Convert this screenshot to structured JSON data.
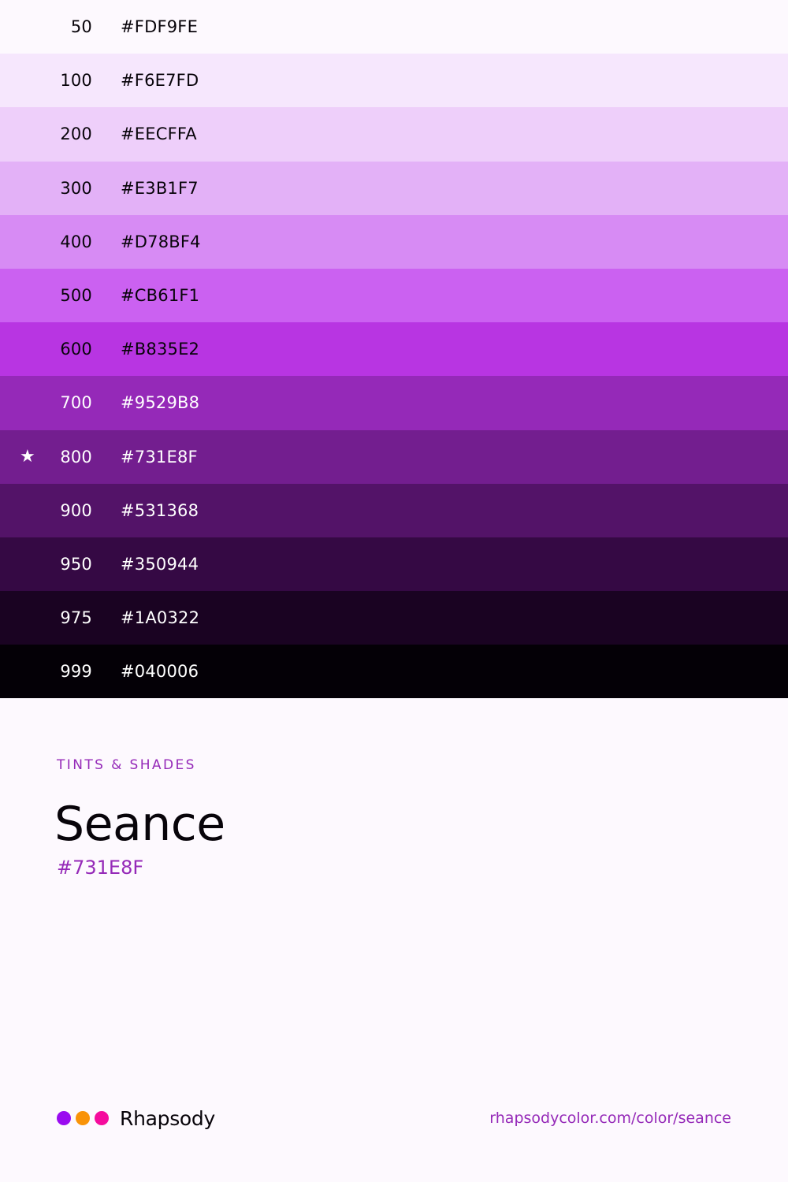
{
  "swatches": [
    {
      "shade": "50",
      "hex": "#FDF9FE",
      "text_color": "#08040A",
      "starred": false
    },
    {
      "shade": "100",
      "hex": "#F6E7FD",
      "text_color": "#08040A",
      "starred": false
    },
    {
      "shade": "200",
      "hex": "#EECFFA",
      "text_color": "#08040A",
      "starred": false
    },
    {
      "shade": "300",
      "hex": "#E3B1F7",
      "text_color": "#08040A",
      "starred": false
    },
    {
      "shade": "400",
      "hex": "#D78BF4",
      "text_color": "#08040A",
      "starred": false
    },
    {
      "shade": "500",
      "hex": "#CB61F1",
      "text_color": "#08040A",
      "starred": false
    },
    {
      "shade": "600",
      "hex": "#B835E2",
      "text_color": "#08040A",
      "starred": false
    },
    {
      "shade": "700",
      "hex": "#9529B8",
      "text_color": "#FFFFFF",
      "starred": false
    },
    {
      "shade": "800",
      "hex": "#731E8F",
      "text_color": "#FFFFFF",
      "starred": true
    },
    {
      "shade": "900",
      "hex": "#531368",
      "text_color": "#FFFFFF",
      "starred": false
    },
    {
      "shade": "950",
      "hex": "#350944",
      "text_color": "#FFFFFF",
      "starred": false
    },
    {
      "shade": "975",
      "hex": "#1A0322",
      "text_color": "#FFFFFF",
      "starred": false
    },
    {
      "shade": "999",
      "hex": "#040006",
      "text_color": "#FFFFFF",
      "starred": false
    }
  ],
  "star_icon": "★",
  "info": {
    "eyebrow": "TINTS & SHADES",
    "color_name": "Seance",
    "color_hex": "#731E8F"
  },
  "footer": {
    "brand_name": "Rhapsody",
    "url": "rhapsodycolor.com/color/seance",
    "logo_dots": [
      "#9A0BF0",
      "#F99308",
      "#F50C9D"
    ]
  },
  "colors": {
    "page_background": "#FDF9FE",
    "accent": "#9529B8",
    "text_dark": "#08040A"
  }
}
